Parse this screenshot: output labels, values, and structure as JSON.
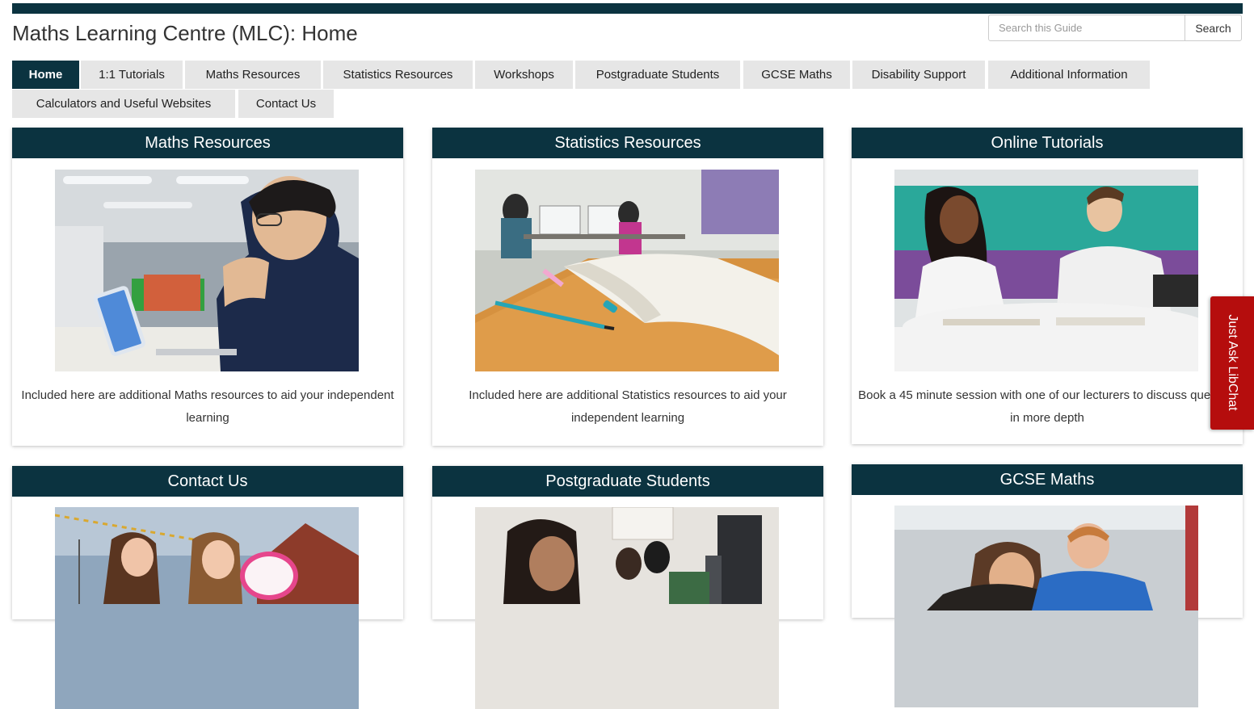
{
  "header": {
    "title": "Maths Learning Centre (MLC): Home",
    "search_placeholder": "Search this Guide",
    "search_button": "Search"
  },
  "nav": {
    "tabs": [
      {
        "label": "Home",
        "active": true
      },
      {
        "label": "1:1 Tutorials"
      },
      {
        "label": "Maths Resources"
      },
      {
        "label": "Statistics Resources"
      },
      {
        "label": "Workshops"
      },
      {
        "label": "Postgraduate Students"
      },
      {
        "label": "GCSE Maths"
      },
      {
        "label": "Disability Support"
      },
      {
        "label": "Additional Information"
      },
      {
        "label": "Calculators and Useful Websites"
      },
      {
        "label": "Contact Us"
      }
    ]
  },
  "cards": [
    {
      "title": "Maths Resources",
      "desc": "Included here are additional Maths resources to aid your independent learning"
    },
    {
      "title": "Statistics Resources",
      "desc": "Included here are additional Statistics resources to aid your independent learning"
    },
    {
      "title": "Online Tutorials",
      "desc": "Book a 45 minute session with one of our lecturers to discuss question in more depth"
    },
    {
      "title": "Contact Us"
    },
    {
      "title": "Postgraduate Students"
    },
    {
      "title": "GCSE Maths"
    }
  ],
  "libchat": {
    "label": "Just Ask LibChat"
  },
  "colors": {
    "brand": "#0b3340",
    "tab_bg": "#e6e6e6",
    "libchat": "#b50d0d"
  },
  "icons": {
    "search": "search-button"
  }
}
